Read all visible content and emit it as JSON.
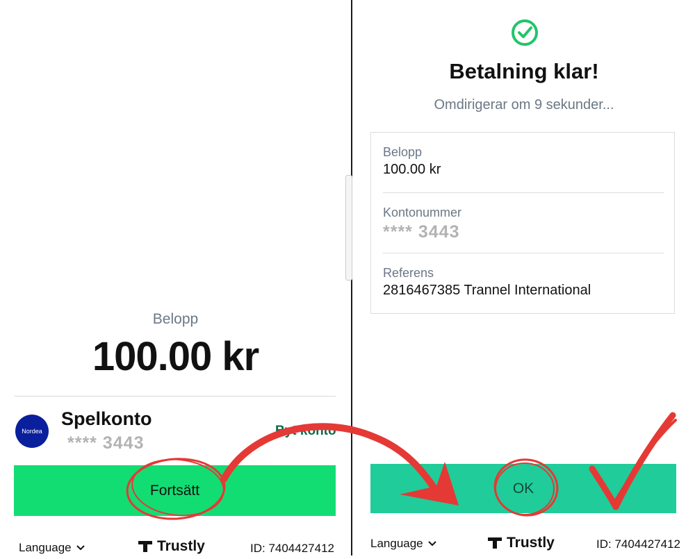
{
  "left": {
    "amount_label": "Belopp",
    "amount_value": "100.00 kr",
    "bank_logo_text": "Nordea",
    "account_name": "Spelkonto",
    "account_number": "**** 3443",
    "switch_account_label": "Byt konto",
    "continue_label": "Fortsätt",
    "footer": {
      "language_label": "Language",
      "brand_name": "Trustly",
      "id_text": "ID: 7404427412"
    }
  },
  "right": {
    "title": "Betalning klar!",
    "redirect_text": "Omdirigerar om 9 sekunder...",
    "details": [
      {
        "label": "Belopp",
        "value": "100.00 kr"
      },
      {
        "label": "Kontonummer",
        "value": "**** 3443"
      },
      {
        "label": "Referens",
        "value": "2816467385 Trannel International"
      }
    ],
    "ok_label": "OK",
    "footer": {
      "language_label": "Language",
      "brand_name": "Trustly",
      "id_text": "ID: 7404427412"
    }
  },
  "colors": {
    "continue_button": "#12dd73",
    "ok_button": "#20cc9a",
    "success_check": "#22c46a",
    "annotation_red": "#e53935",
    "nordea_blue": "#0a1f9c"
  }
}
